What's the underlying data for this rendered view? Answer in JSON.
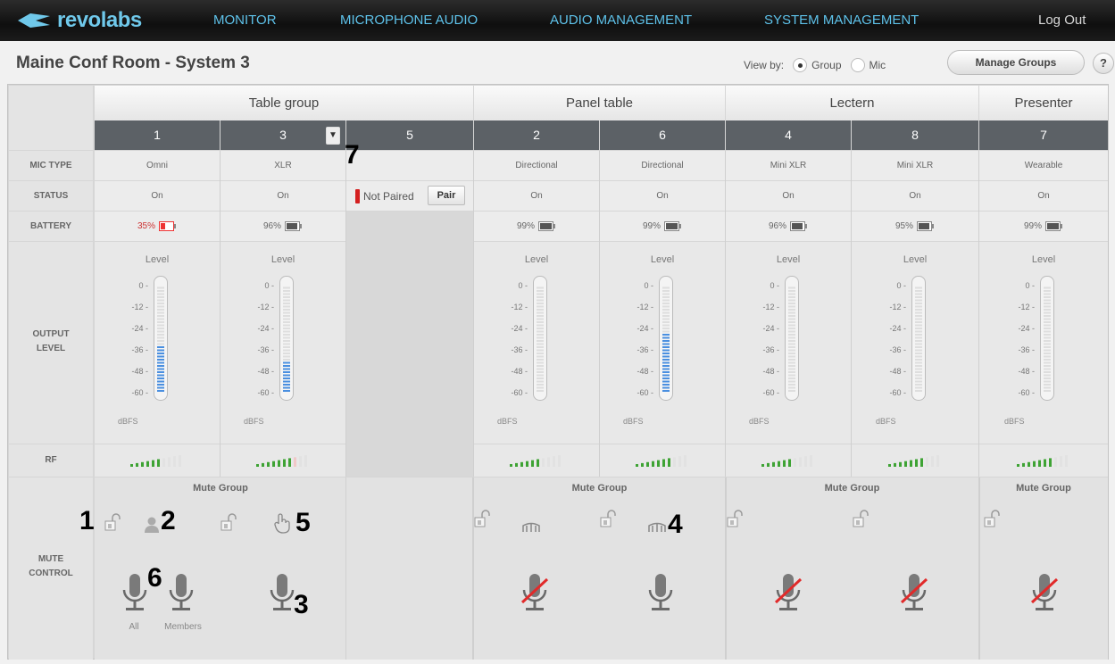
{
  "nav": {
    "logo": "revolabs",
    "items": [
      "MONITOR",
      "MICROPHONE AUDIO",
      "AUDIO MANAGEMENT",
      "SYSTEM MANAGEMENT"
    ],
    "logout": "Log Out"
  },
  "page_title": "Maine Conf Room - System 3",
  "view_by": {
    "label": "View by:",
    "options": [
      "Group",
      "Mic"
    ],
    "selected": "Group"
  },
  "manage_groups": "Manage Groups",
  "help": "?",
  "groups": [
    "Table group",
    "Panel table",
    "Lectern",
    "Presenter"
  ],
  "row_labels": {
    "mic_type": "MIC TYPE",
    "status": "STATUS",
    "battery": "BATTERY",
    "output_level_1": "OUTPUT",
    "output_level_2": "LEVEL",
    "rf": "RF",
    "mute_control_1": "MUTE",
    "mute_control_2": "CONTROL"
  },
  "mics": [
    {
      "num": "1",
      "type": "Omni",
      "status": "On",
      "battery": "35%",
      "battery_level": 0.35,
      "level_fill": 0.45,
      "rf": 6
    },
    {
      "num": "3",
      "type": "XLR",
      "status": "On",
      "battery": "96%",
      "battery_level": 0.96,
      "level_fill": 0.3,
      "rf": 7
    },
    {
      "num": "5",
      "type": "",
      "status": "Not Paired",
      "pair": "Pair",
      "battery": "",
      "rf": 0
    },
    {
      "num": "2",
      "type": "Directional",
      "status": "On",
      "battery": "99%",
      "battery_level": 0.99,
      "level_fill": 0,
      "rf": 6
    },
    {
      "num": "6",
      "type": "Directional",
      "status": "On",
      "battery": "99%",
      "battery_level": 0.99,
      "level_fill": 0.55,
      "rf": 7
    },
    {
      "num": "4",
      "type": "Mini XLR",
      "status": "On",
      "battery": "96%",
      "battery_level": 0.96,
      "level_fill": 0,
      "rf": 6
    },
    {
      "num": "8",
      "type": "Mini XLR",
      "status": "On",
      "battery": "95%",
      "battery_level": 0.95,
      "level_fill": 0,
      "rf": 7
    },
    {
      "num": "7",
      "type": "Wearable",
      "status": "On",
      "battery": "99%",
      "battery_level": 0.99,
      "level_fill": 0,
      "rf": 7
    }
  ],
  "meter": {
    "title": "Level",
    "ticks": [
      "0 -",
      "-12 -",
      "-24 -",
      "-36 -",
      "-48 -",
      "-60 -"
    ],
    "unit": "dBFS"
  },
  "mute_group_label": "Mute Group",
  "mute_all_labels": [
    "All",
    "Members"
  ],
  "callouts": [
    "1",
    "2",
    "3",
    "4",
    "5",
    "6",
    "7"
  ],
  "colors": {
    "nav_bg": "#141414",
    "nav_text": "#5ec2ea",
    "num_bar": "#5c6166",
    "meter_blue": "#4a8fe0",
    "rf_green": "#3ea334",
    "mute_red": "#e12a2a",
    "battery_low": "#e33"
  }
}
